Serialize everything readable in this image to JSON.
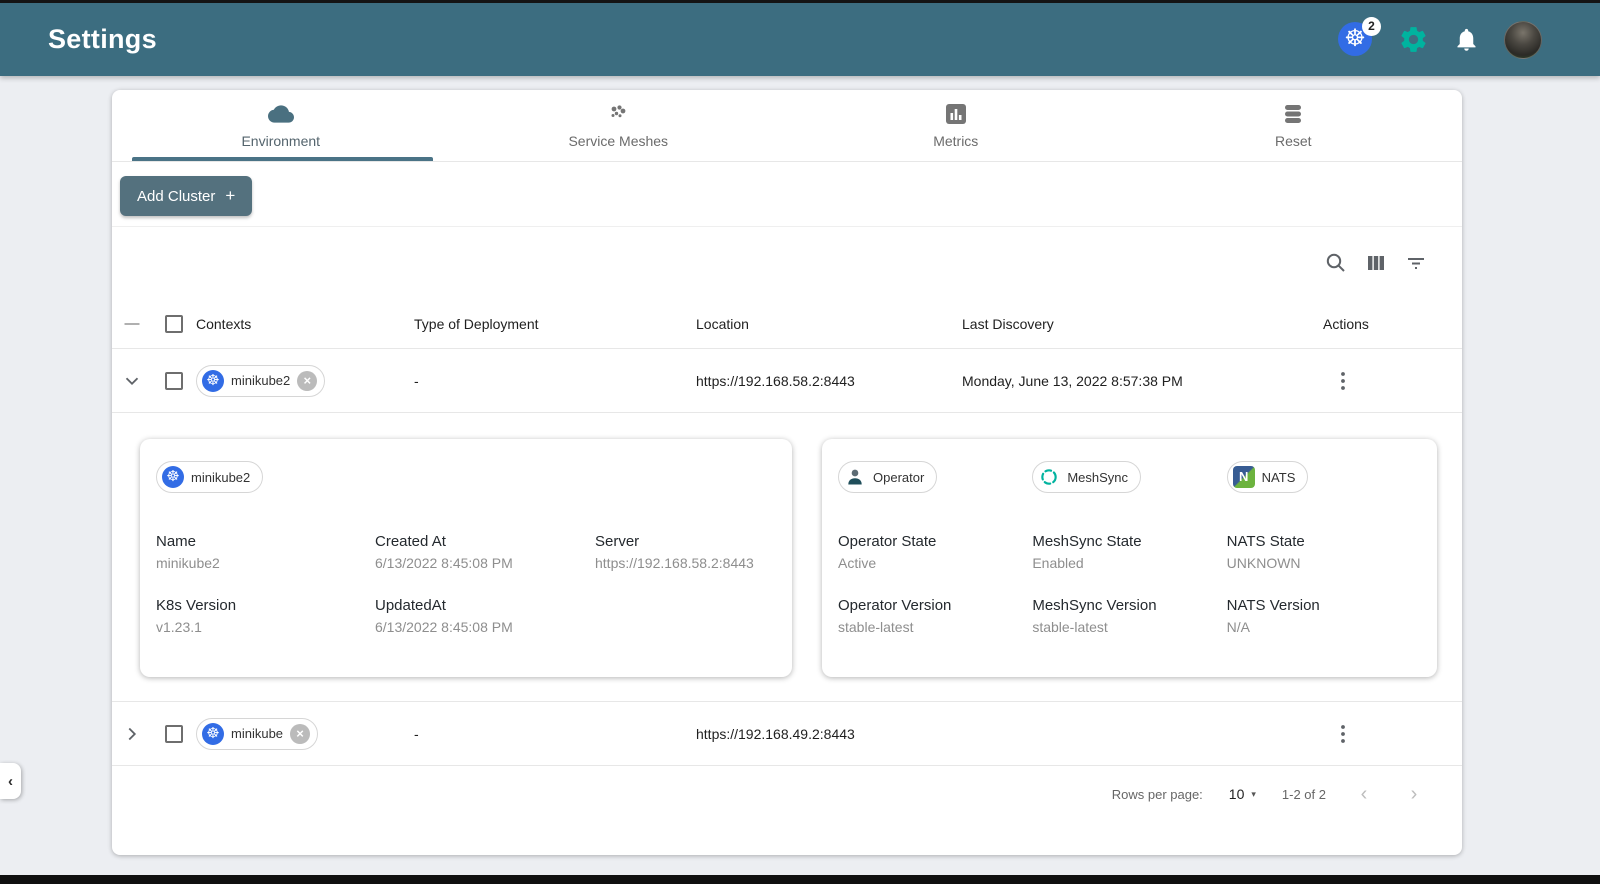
{
  "header": {
    "title": "Settings",
    "k8s_context_count": "2"
  },
  "tabs": [
    {
      "label": "Environment"
    },
    {
      "label": "Service Meshes"
    },
    {
      "label": "Metrics"
    },
    {
      "label": "Reset"
    }
  ],
  "toolbar": {
    "add_cluster": "Add Cluster",
    "plus": "+"
  },
  "table": {
    "columns": [
      "Contexts",
      "Type of Deployment",
      "Location",
      "Last Discovery",
      "Actions"
    ],
    "rows": [
      {
        "context": "minikube2",
        "type_of_deployment": "-",
        "location": "https://192.168.58.2:8443",
        "last_discovery": "Monday, June 13, 2022 8:57:38 PM"
      },
      {
        "context": "minikube",
        "type_of_deployment": "-",
        "location": "https://192.168.49.2:8443",
        "last_discovery": ""
      }
    ]
  },
  "cluster_detail": {
    "chip": "minikube2",
    "fields": [
      {
        "label": "Name",
        "value": "minikube2"
      },
      {
        "label": "Created At",
        "value": "6/13/2022 8:45:08 PM"
      },
      {
        "label": "Server",
        "value": "https://192.168.58.2:8443"
      },
      {
        "label": "K8s Version",
        "value": "v1.23.1"
      },
      {
        "label": "UpdatedAt",
        "value": "6/13/2022 8:45:08 PM"
      }
    ]
  },
  "services": [
    {
      "chip": "Operator",
      "state_label": "Operator State",
      "state": "Active",
      "version_label": "Operator Version",
      "version": "stable-latest"
    },
    {
      "chip": "MeshSync",
      "state_label": "MeshSync State",
      "state": "Enabled",
      "version_label": "MeshSync Version",
      "version": "stable-latest"
    },
    {
      "chip": "NATS",
      "state_label": "NATS State",
      "state": "UNKNOWN",
      "version_label": "NATS Version",
      "version": "N/A"
    }
  ],
  "pagination": {
    "rows_per_page_label": "Rows per page:",
    "rows_per_page": "10",
    "range": "1-2 of 2"
  },
  "icons": {
    "k8s": "☸",
    "close": "×",
    "minus": "—",
    "caret": "▾",
    "chevron_left": "‹",
    "chevron_right": "›",
    "collapse": "‹",
    "nats_letter": "N"
  },
  "colors": {
    "header_bg": "#3C6D80",
    "accent_green": "#00B39F",
    "k8s_blue": "#326CE5",
    "button_slate": "#54717E",
    "tab_indicator": "#4A7386"
  }
}
